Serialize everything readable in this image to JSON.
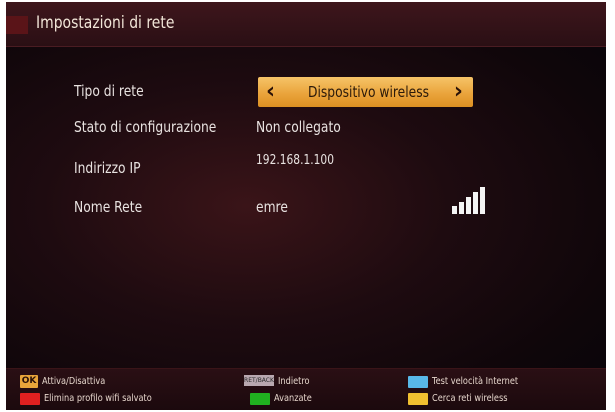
{
  "header": {
    "title": "Impostazioni di rete"
  },
  "settings": {
    "network_type": {
      "label": "Tipo di rete",
      "value": "Dispositivo wireless"
    },
    "config_status": {
      "label": "Stato di configurazione",
      "value": "Non collegato"
    },
    "ip_address": {
      "label": "Indirizzo IP",
      "value": "192.168.1.100"
    },
    "network_name": {
      "label": "Nome Rete",
      "value": "emre",
      "signal_icon": "wifi-signal-icon"
    }
  },
  "footer": {
    "ok": {
      "key": "OK",
      "label": "Attiva/Disattiva"
    },
    "back": {
      "key": "RET/BACK",
      "label": "Indietro"
    },
    "blue": {
      "label": "Test velocità Internet",
      "color": "#58b8e8"
    },
    "red": {
      "label": "Elimina profilo wifi salvato",
      "color": "#e02020"
    },
    "green": {
      "label": "Avanzate",
      "color": "#20b020"
    },
    "yellow": {
      "label": "Cerca reti wireless",
      "color": "#f0c030"
    }
  }
}
